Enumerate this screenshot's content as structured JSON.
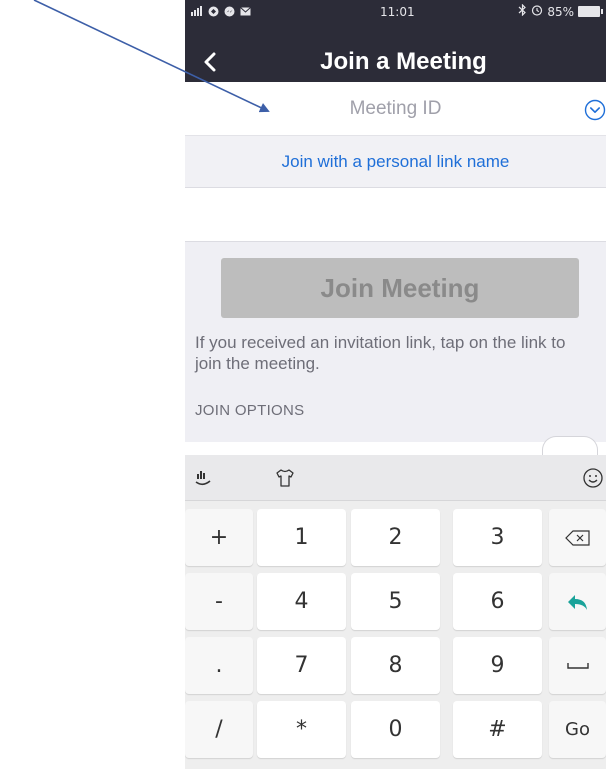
{
  "status_bar": {
    "time": "11:01",
    "battery": "85%",
    "left_icons": [
      "signal-icon",
      "app-badge-icon",
      "messenger-icon",
      "mail-icon"
    ],
    "right_icons": [
      "bluetooth-icon",
      "alarm-icon",
      "battery-icon"
    ]
  },
  "nav": {
    "title": "Join a Meeting",
    "back_icon": "chevron-left-icon"
  },
  "meeting_id": {
    "value": "",
    "placeholder": "Meeting ID",
    "dropdown_icon": "chevron-down-circle-icon"
  },
  "personal_link": {
    "label": "Join with a personal link name"
  },
  "join_button": {
    "label": "Join Meeting",
    "enabled": false
  },
  "info": {
    "text": "If you received an invitation link, tap on the link to join the meeting."
  },
  "join_options": {
    "header": "JOIN OPTIONS"
  },
  "keyboard": {
    "toolbar_icons": [
      "handwriting-icon",
      "theme-shirt-icon",
      "emoji-icon"
    ],
    "rows": [
      [
        "+",
        "1",
        "2",
        "3",
        "backspace"
      ],
      [
        "-",
        "4",
        "5",
        "6",
        "enter"
      ],
      [
        ".",
        "7",
        "8",
        "9",
        "space"
      ],
      [
        "/",
        "*",
        "0",
        "#",
        "Go"
      ]
    ]
  },
  "colors": {
    "status_bar_bg": "#2c2c38",
    "link_blue": "#1f6fd8",
    "annotation_arrow": "#3d5fa8",
    "join_button_bg": "#bdbdbd",
    "enter_key_accent": "#1aa39a"
  }
}
